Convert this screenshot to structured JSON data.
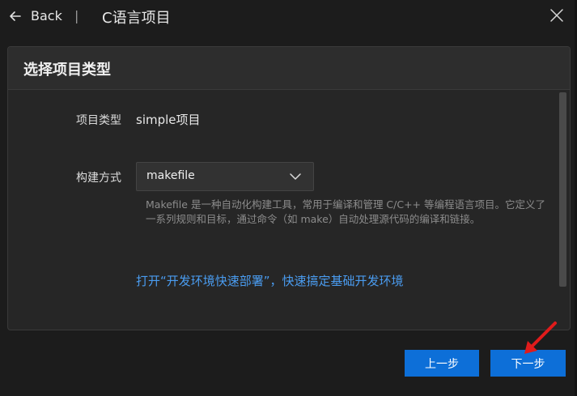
{
  "title_bar": {
    "back_label": "Back",
    "separator": "|",
    "title": "C语言项目",
    "icons": {
      "back": "arrow-left-icon",
      "close": "close-icon"
    }
  },
  "panel": {
    "title": "选择项目类型",
    "project_type": {
      "label": "项目类型",
      "value": "simple项目"
    },
    "build_method": {
      "label": "构建方式",
      "selected": "makefile",
      "description": "Makefile 是一种自动化构建工具，常用于编译和管理 C/C++ 等编程语言项目。它定义了一系列规则和目标，通过命令（如 make）自动处理源代码的编译和链接。"
    },
    "link_text": "打开“开发环境快速部署”，快速搞定基础开发环境"
  },
  "footer": {
    "prev_label": "上一步",
    "next_label": "下一步"
  },
  "colors": {
    "background": "#1c1c1c",
    "panel": "#262626",
    "accent": "#0d6fd8",
    "link": "#4a9cf0",
    "annotation": "#e01b1b"
  }
}
